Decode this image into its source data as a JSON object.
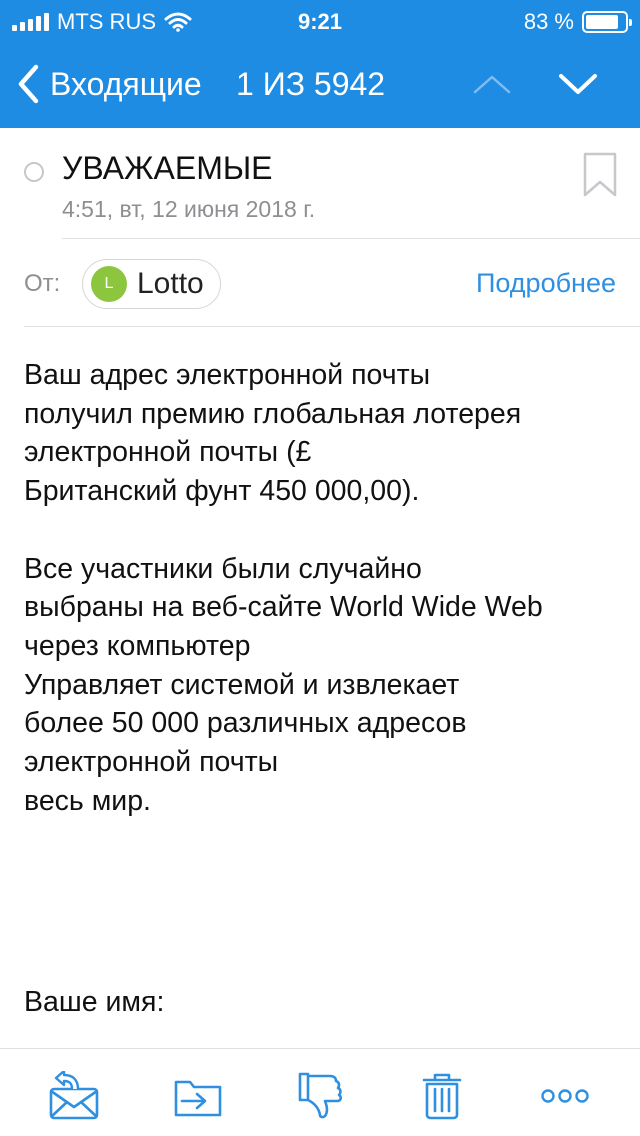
{
  "status_bar": {
    "carrier": "MTS RUS",
    "time": "9:21",
    "battery": "83 %",
    "battery_level": 0.83
  },
  "nav": {
    "back_label": "Входящие",
    "counter": "1 ИЗ 5942"
  },
  "message": {
    "subject": "УВАЖАЕМЫЕ",
    "date": "4:51, вт, 12 июня 2018 г.",
    "from_label": "От:",
    "sender_initial": "L",
    "sender_name": "Lotto",
    "details_link": "Подробнее",
    "body_lines": [
      "Ваш адрес электронной почты",
      "получил премию глобальная лотерея",
      "электронной почты (£",
      "Британский фунт 450 000,00).",
      "",
      "Все участники были случайно",
      "выбраны на веб-сайте World Wide Web",
      "через компьютер",
      "Управляет системой и извлекает",
      "более 50 000 различных адресов",
      "электронной почты",
      "весь мир."
    ],
    "closing_line": "Ваше имя:"
  },
  "toolbar": {
    "items": [
      "reply-icon",
      "move-to-folder-icon",
      "spam-dislike-icon",
      "trash-icon",
      "more-icon"
    ]
  },
  "colors": {
    "header_blue": "#1f8ce3",
    "link_blue": "#2f8fe0",
    "icon_blue": "#2f8fe0",
    "sender_green": "#8cc63f",
    "secondary_gray": "#8e8e93"
  }
}
